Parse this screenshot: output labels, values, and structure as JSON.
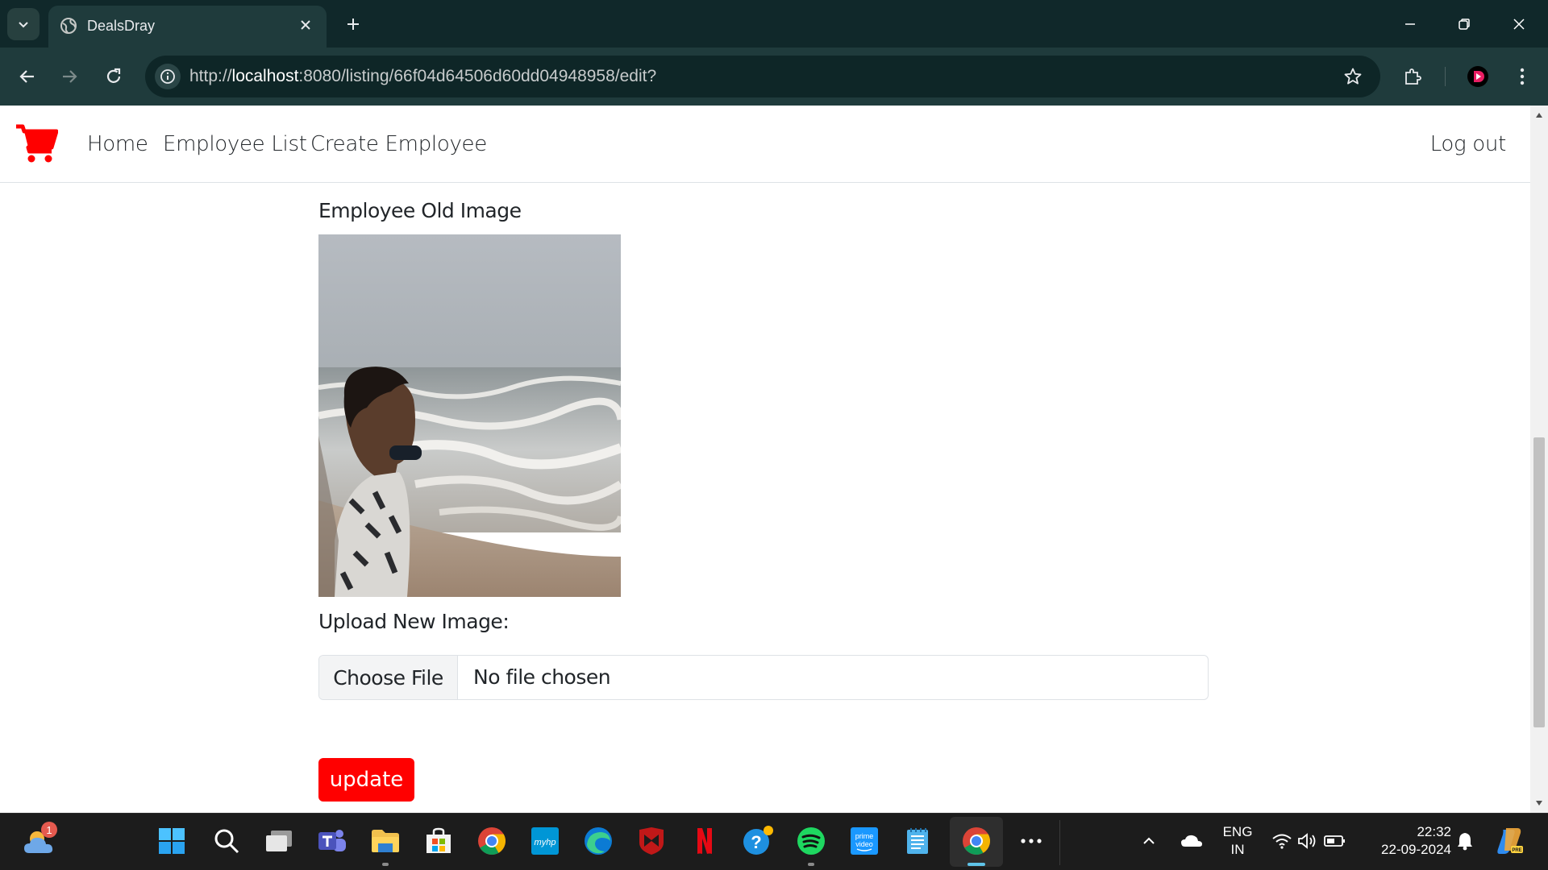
{
  "browser": {
    "tab_title": "DealsDray",
    "url_scheme": "http://",
    "url_host": "localhost",
    "url_rest": ":8080/listing/66f04d64506d60dd04948958/edit?"
  },
  "navbar": {
    "links": [
      "Home",
      "Employee List",
      "Create Employee"
    ],
    "logout": "Log out",
    "brand_color": "#ff0000"
  },
  "form": {
    "old_image_label": "Employee Old Image",
    "upload_label": "Upload New Image:",
    "choose_file": "Choose File",
    "file_status": "No file chosen",
    "update_button": "update",
    "accent_color": "#ff0000"
  },
  "taskbar": {
    "weather_badge": "1",
    "lang_top": "ENG",
    "lang_bottom": "IN",
    "time": "22:32",
    "date": "22-09-2024",
    "apps": [
      "weather",
      "start",
      "search",
      "task-view",
      "teams",
      "file-explorer",
      "store",
      "chrome",
      "myhp",
      "edge",
      "mcafee",
      "netflix",
      "help",
      "spotify",
      "prime-video",
      "notepad",
      "chrome-active",
      "more"
    ]
  }
}
